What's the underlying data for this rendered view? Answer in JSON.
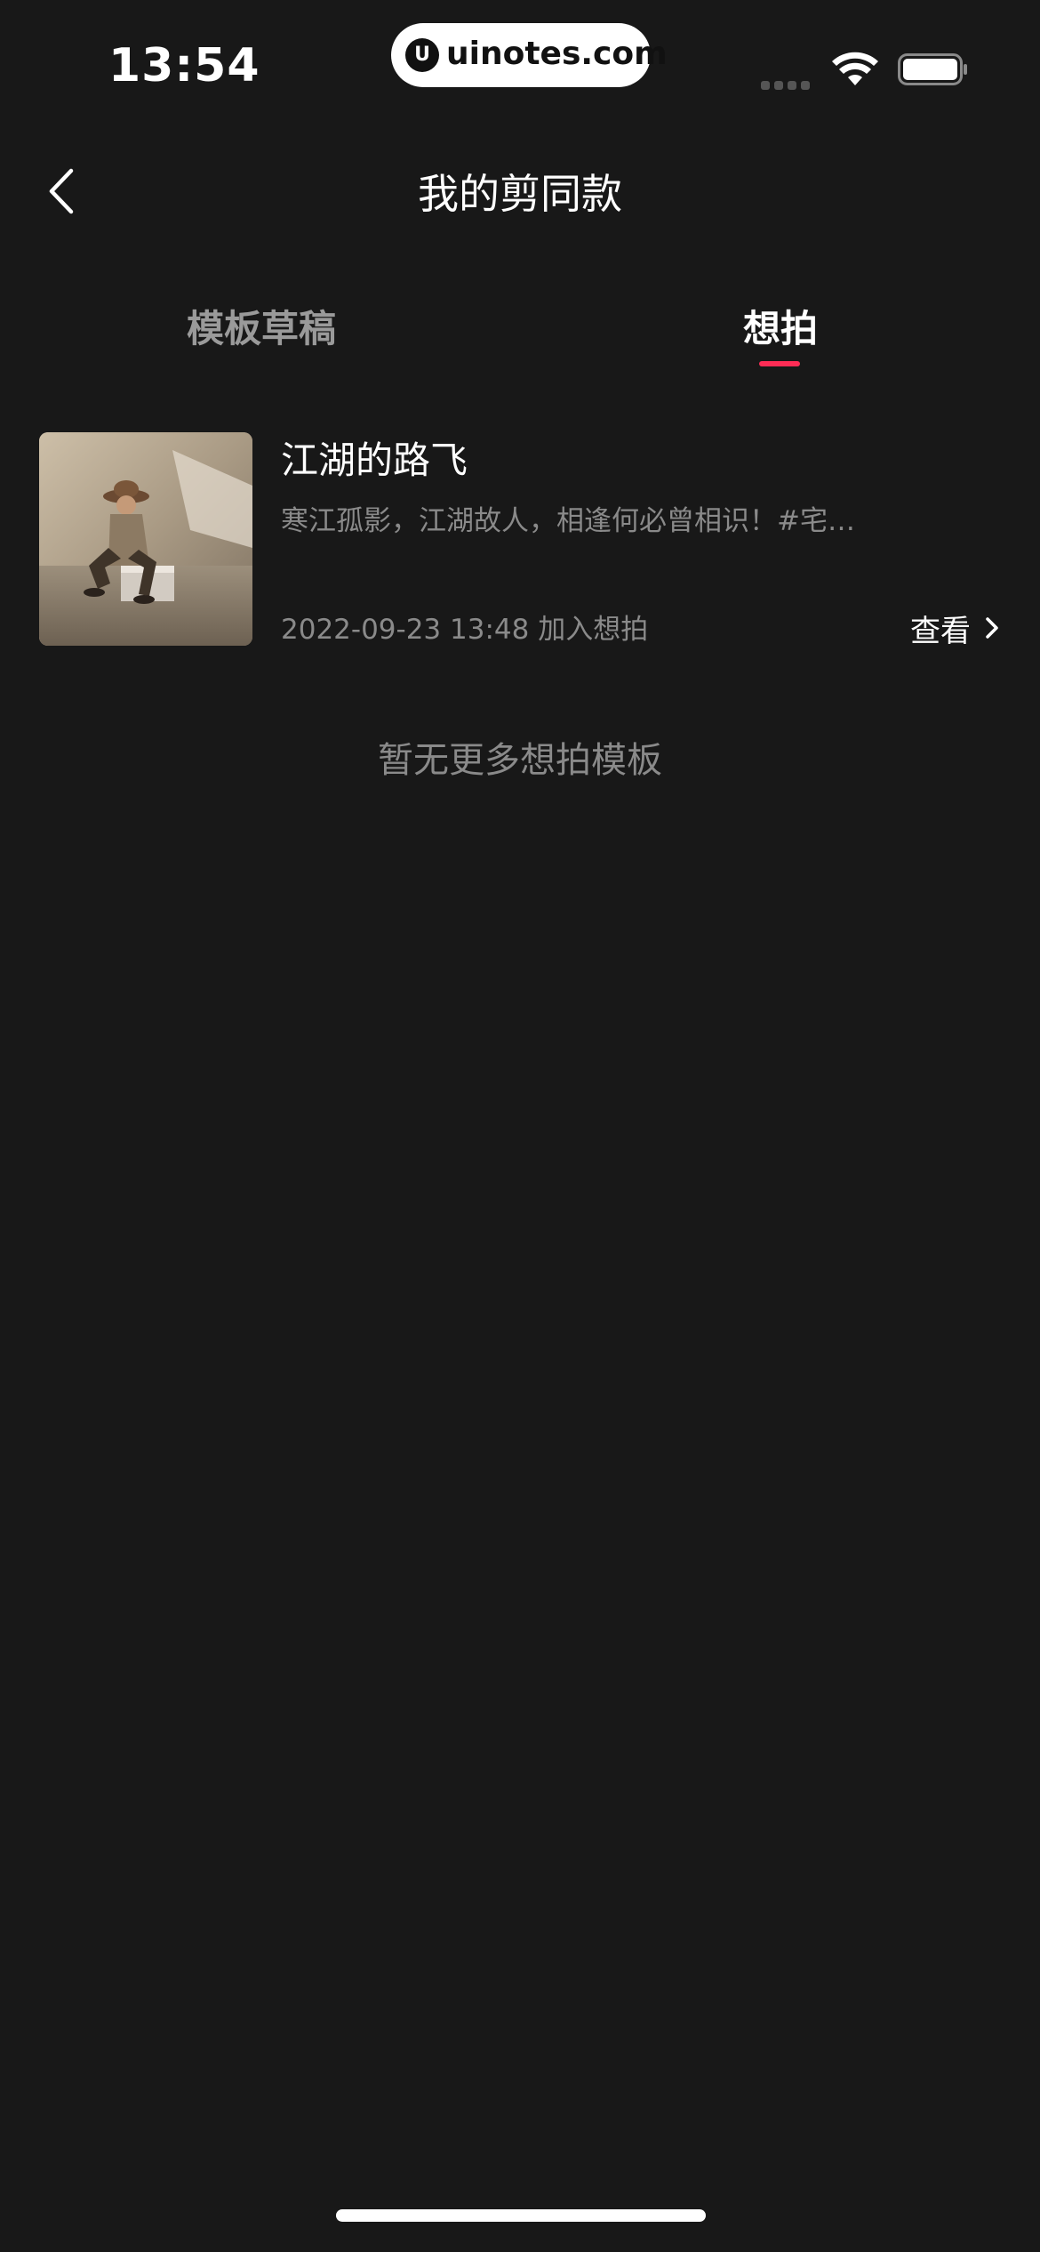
{
  "status_bar": {
    "time": "13:54",
    "watermark_logo": "U",
    "watermark": "uinotes.com",
    "icons": [
      "signal-icon",
      "wifi-icon",
      "battery-icon"
    ]
  },
  "header": {
    "title": "我的剪同款",
    "back_icon": "chevron-left-icon"
  },
  "tabs": [
    {
      "label": "模板草稿",
      "active": false
    },
    {
      "label": "想拍",
      "active": true
    }
  ],
  "colors": {
    "background": "#181818",
    "accent": "#fe2c55",
    "text_primary": "#ffffff",
    "text_secondary": "#8a8a8a"
  },
  "items": [
    {
      "title": "江湖的路飞",
      "description": "寒江孤影，江湖故人，相逢何必曾相识！#宅…",
      "date": "2022-09-23 13:48 加入想拍",
      "action_label": "查看",
      "action_icon": "chevron-right-icon"
    }
  ],
  "empty_message": "暂无更多想拍模板"
}
